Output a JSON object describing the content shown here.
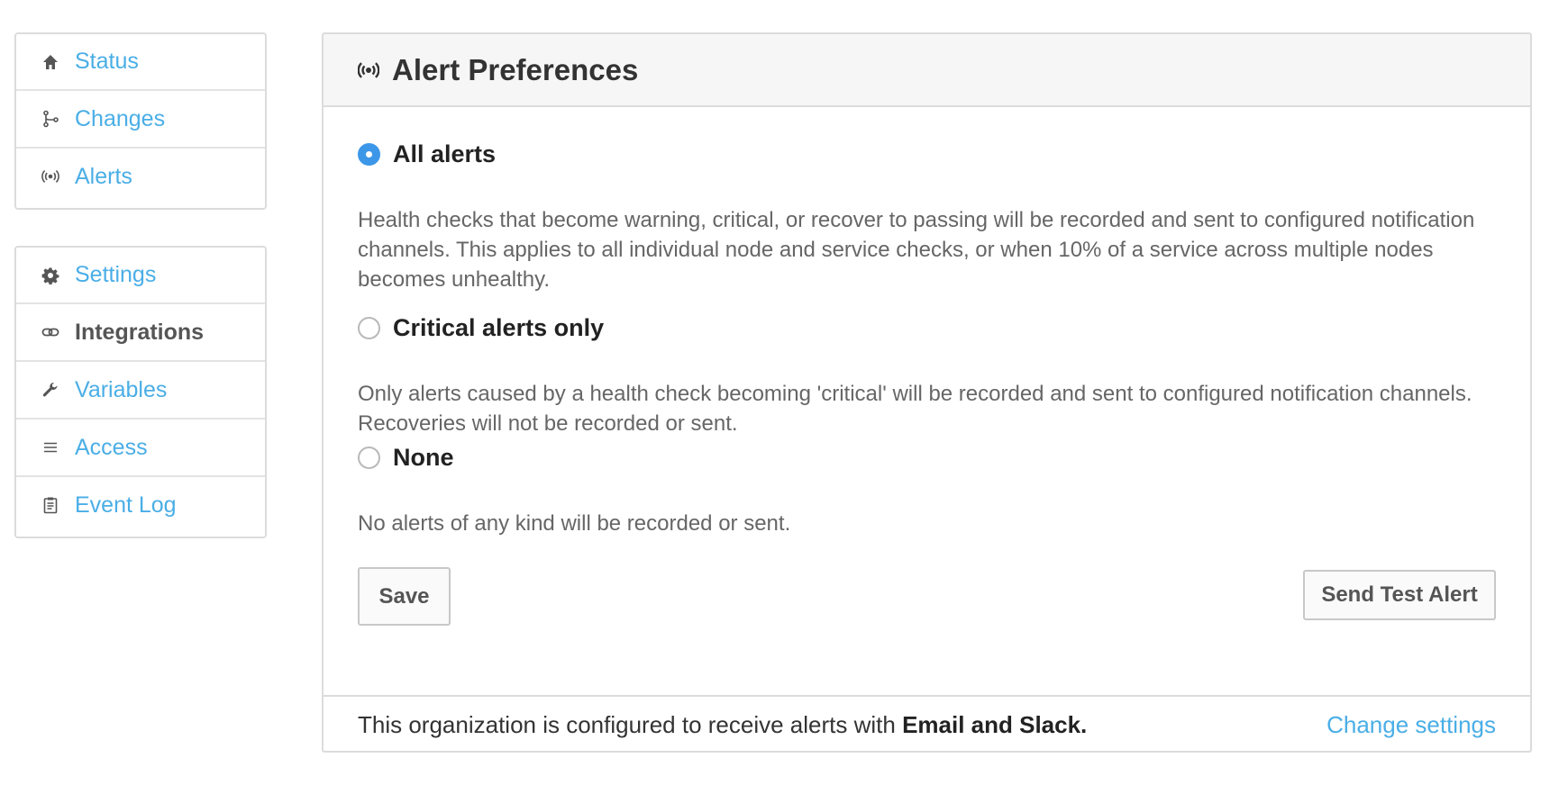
{
  "sidebar": {
    "group1": [
      {
        "label": "Status",
        "icon": "home-icon"
      },
      {
        "label": "Changes",
        "icon": "git-branch-icon"
      },
      {
        "label": "Alerts",
        "icon": "broadcast-icon"
      }
    ],
    "group2": [
      {
        "label": "Settings",
        "icon": "gear-icon"
      },
      {
        "label": "Integrations",
        "icon": "link-icon",
        "active": true
      },
      {
        "label": "Variables",
        "icon": "wrench-icon"
      },
      {
        "label": "Access",
        "icon": "list-icon"
      },
      {
        "label": "Event Log",
        "icon": "clipboard-icon"
      }
    ]
  },
  "panel": {
    "title": "Alert Preferences",
    "icon": "broadcast-icon",
    "options": [
      {
        "label": "All alerts",
        "checked": true,
        "description": "Health checks that become warning, critical, or recover to passing will be recorded and sent to configured notification channels. This applies to all individual node and service checks, or when 10% of a service across multiple nodes becomes unhealthy."
      },
      {
        "label": "Critical alerts only",
        "checked": false,
        "description": "Only alerts caused by a health check becoming 'critical' will be recorded and sent to configured notification channels. Recoveries will not be recorded or sent."
      },
      {
        "label": "None",
        "checked": false,
        "description": "No alerts of any kind will be recorded or sent."
      }
    ],
    "save_label": "Save",
    "test_label": "Send Test Alert",
    "footer": {
      "text_prefix": "This organization is configured to receive alerts with ",
      "text_bold": "Email and Slack.",
      "link_label": "Change settings"
    }
  },
  "colors": {
    "accent": "#4aaee6",
    "radio_checked": "#3d97e8"
  }
}
